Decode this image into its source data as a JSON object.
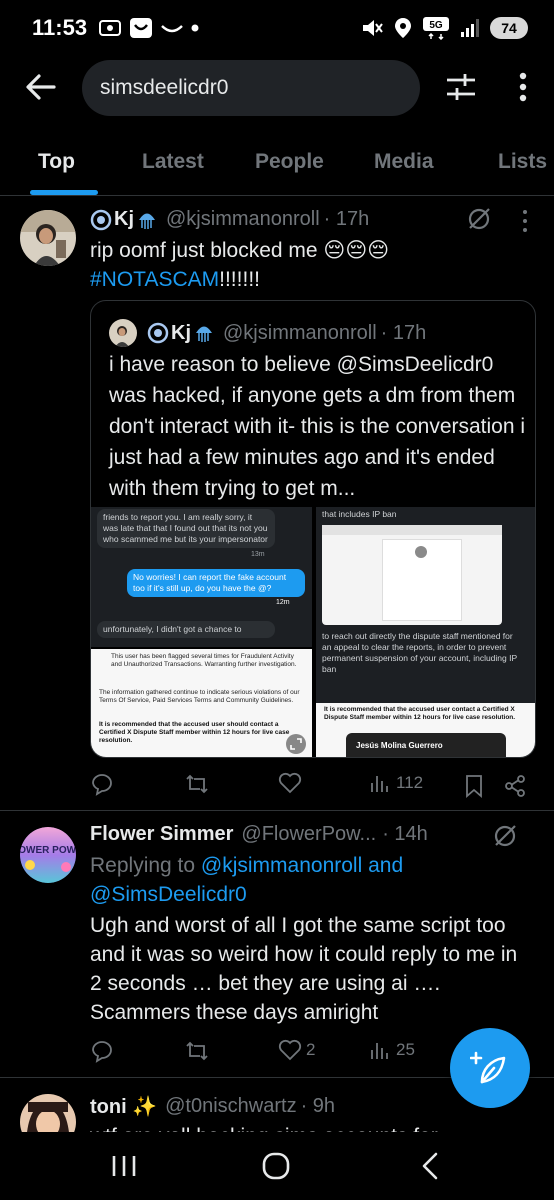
{
  "status_bar": {
    "time": "11:53",
    "battery": "74",
    "network": "5G",
    "icons": [
      "screenshot-icon",
      "notification-icon",
      "dot-icon",
      "mute-icon",
      "location-icon",
      "network-icon",
      "signal-icon"
    ]
  },
  "search": {
    "query": "simsdeelicdr0"
  },
  "tabs": [
    {
      "label": "Top",
      "active": true
    },
    {
      "label": "Latest",
      "active": false
    },
    {
      "label": "People",
      "active": false
    },
    {
      "label": "Media",
      "active": false
    },
    {
      "label": "Lists",
      "active": false
    }
  ],
  "tweets": [
    {
      "name": "Kj",
      "handle": "@kjsimmanonroll",
      "time": "· 17h",
      "text_line1": "rip oomf just blocked me 😔😔😔",
      "hashtag": "#NOTASCAM",
      "hashtag_suffix": "!!!!!!!",
      "quote": {
        "name": "Kj",
        "handle": "@kjsimmanonroll",
        "time": "· 17h",
        "text": "i have reason to believe @SimsDeelicdr0 was hacked, if anyone gets a dm from them don't interact with it- this is the conversation i just had a few minutes ago and it's ended with them trying to get m...",
        "images": {
          "chat_top": "friends to report you. I am really sorry, it was late that that I found out that its not you who scammed me but its your impersonator",
          "chat_time1": "13m",
          "chat_reply": "No worries! I can report the fake account too if it's still up, do you have the @?",
          "chat_time2": "12m",
          "chat_bottom": "unfortunately, I didn't got a chance to",
          "doc1_line1": "This user has been flagged several times for Fraudulent Activity and Unauthorized Transactions. Warranting further investigation.",
          "doc1_line2": "The information gathered continue to indicate serious violations of our Terms Of Service, Paid Services Terms and Community Guidelines.",
          "doc1_bold": "It is recommended that the accused user should contact a Certified X Dispute Staff member within 12 hours for live case resolution.",
          "right_top": "that includes IP ban",
          "right_mid": "to reach out directly the dispute staff mentioned for an appeal to clear the reports, in order to prevent permanent suspension of your account, including IP ban",
          "right_bold": "It is recommended that the accused user contact a Certified X Dispute Staff member within 12 hours for live case resolution.",
          "right_name": "Jesús Molina Guerrero"
        }
      },
      "actions": {
        "replies": "",
        "retweets": "",
        "likes": "",
        "views": "112"
      }
    },
    {
      "name": "Flower Simmer",
      "handle": "@FlowerPow...",
      "time": "· 14h",
      "avatar_text": "FLOWER POWER",
      "replying_to_prefix": "Replying to",
      "replying_to_1": "@kjsimmanonroll",
      "replying_to_and": "and",
      "replying_to_2": "@SimsDeelicdr0",
      "text": "Ugh and worst of all I got the same script too and it was so weird how it could reply to me in 2 seconds … bet they are using ai …. Scammers these days amiright",
      "actions": {
        "replies": "",
        "retweets": "",
        "likes": "2",
        "views": "25"
      }
    },
    {
      "name": "toni ✨",
      "handle": "@t0nischwartz",
      "time": "· 9h",
      "text": "wtf are yall hacking sims accounts for"
    }
  ],
  "colors": {
    "accent": "#1d9bf0",
    "background": "#000000",
    "muted": "#71767b",
    "text": "#e7e9ea",
    "border": "#2f3336"
  }
}
